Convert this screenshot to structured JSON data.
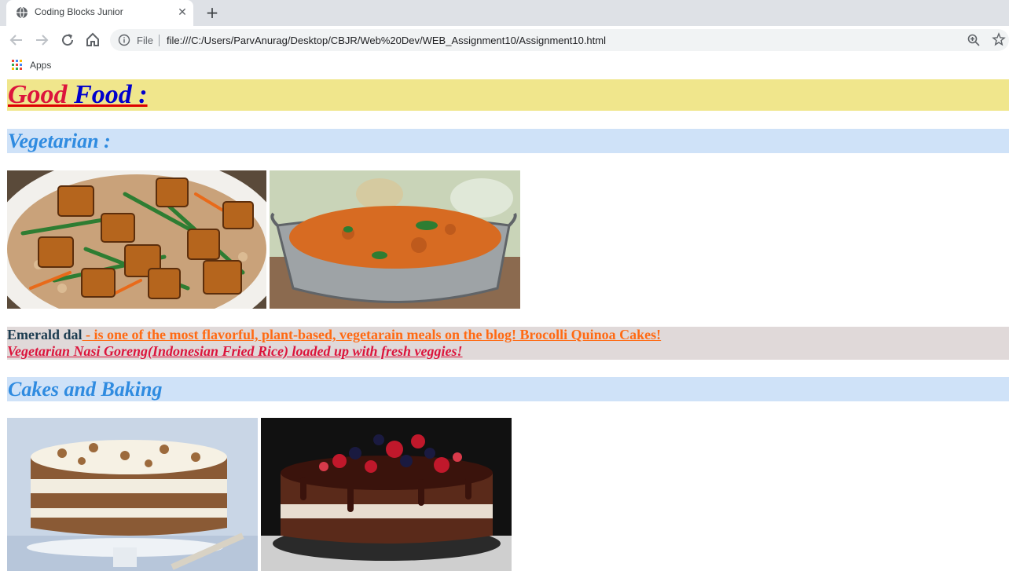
{
  "browser": {
    "tab_title": "Coding Blocks Junior",
    "scheme_label": "File",
    "url": "file:///C:/Users/ParvAnurag/Desktop/CBJR/Web%20Dev/WEB_Assignment10/Assignment10.html",
    "bookmark_apps": "Apps"
  },
  "page": {
    "title_word1": "Good",
    "title_word2": "Food :",
    "sections": [
      {
        "heading": "Vegetarian :",
        "images": [
          "tofu-stir-fry-image",
          "dal-curry-image"
        ]
      },
      {
        "heading": "Cakes and Baking",
        "images": [
          "carrot-cake-image",
          "chocolate-berry-cake-image"
        ]
      }
    ],
    "description": {
      "name": "Emerald dal",
      "text": " - is one of the most flavorful, plant-based, vegetarain meals on the blog! Brocolli Quinoa Cakes!",
      "line2": "Vegetarian Nasi Goreng(Indonesian Fried Rice) loaded up with fresh veggies!"
    },
    "colors": {
      "title_bg": "#f0e68c",
      "section_bg": "#cfe2f8",
      "section_text": "#2f8be0",
      "desc_bg": "#e0d9d9"
    }
  }
}
